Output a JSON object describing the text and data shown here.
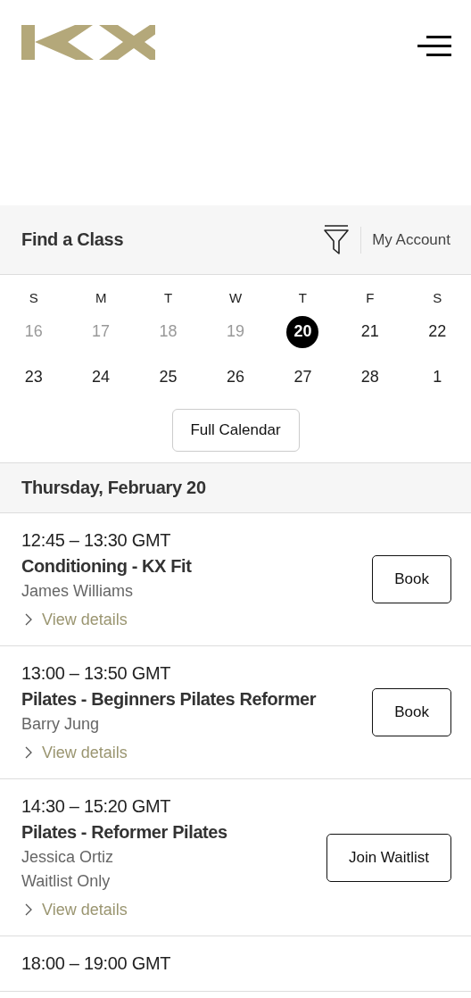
{
  "toolbar": {
    "title": "Find a Class",
    "account_link": "My Account"
  },
  "calendar": {
    "weekdays": [
      "S",
      "M",
      "T",
      "W",
      "T",
      "F",
      "S"
    ],
    "weeks": [
      [
        {
          "day": "16",
          "past": true,
          "selected": false
        },
        {
          "day": "17",
          "past": true,
          "selected": false
        },
        {
          "day": "18",
          "past": true,
          "selected": false
        },
        {
          "day": "19",
          "past": true,
          "selected": false
        },
        {
          "day": "20",
          "past": false,
          "selected": true
        },
        {
          "day": "21",
          "past": false,
          "selected": false
        },
        {
          "day": "22",
          "past": false,
          "selected": false
        }
      ],
      [
        {
          "day": "23",
          "past": false,
          "selected": false
        },
        {
          "day": "24",
          "past": false,
          "selected": false
        },
        {
          "day": "25",
          "past": false,
          "selected": false
        },
        {
          "day": "26",
          "past": false,
          "selected": false
        },
        {
          "day": "27",
          "past": false,
          "selected": false
        },
        {
          "day": "28",
          "past": false,
          "selected": false
        },
        {
          "day": "1",
          "past": false,
          "selected": false
        }
      ]
    ],
    "full_calendar_button": "Full Calendar"
  },
  "date_heading": "Thursday, February 20",
  "classes": [
    {
      "time": "12:45 – 13:30 GMT",
      "title": "Conditioning - KX Fit",
      "instructor": "James Williams",
      "details_link": "View details",
      "action": "Book"
    },
    {
      "time": "13:00 – 13:50 GMT",
      "title": "Pilates - Beginners Pilates Reformer",
      "instructor": "Barry Jung",
      "details_link": "View details",
      "action": "Book"
    },
    {
      "time": "14:30 – 15:20 GMT",
      "title": "Pilates - Reformer Pilates",
      "instructor": "Jessica Ortiz",
      "note": "Waitlist Only",
      "details_link": "View details",
      "action": "Join Waitlist"
    },
    {
      "time": "18:00 – 19:00 GMT"
    }
  ]
}
